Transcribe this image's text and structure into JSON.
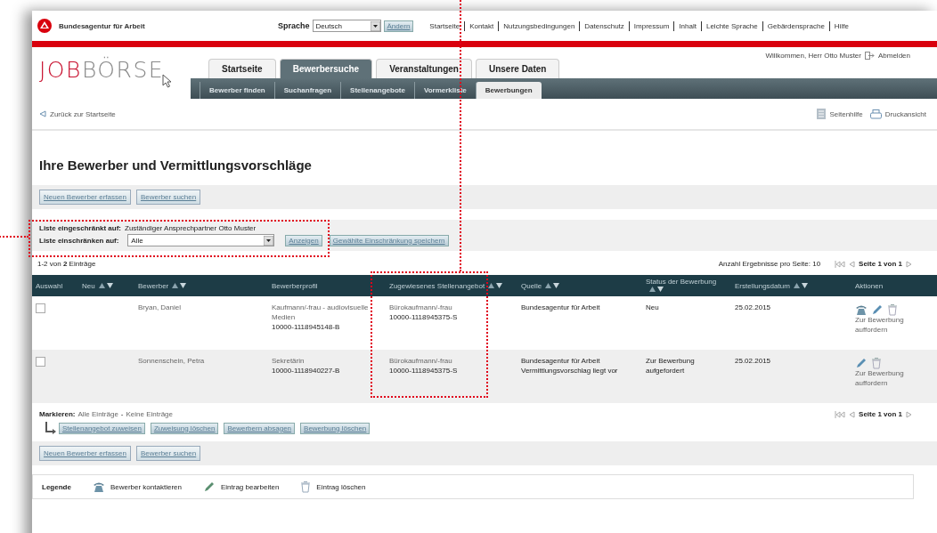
{
  "header": {
    "agency": "Bundesagentur für Arbeit",
    "language_label": "Sprache",
    "language_value": "Deutsch",
    "language_button": "Ändern",
    "links": [
      "Startseite",
      "Kontakt",
      "Nutzungsbedingungen",
      "Datenschutz",
      "Impressum",
      "Inhalt",
      "Leichte Sprache",
      "Gebärdensprache",
      "Hilfe"
    ]
  },
  "logo": {
    "accent": "JOB",
    "rest": "BÖRSE"
  },
  "user": {
    "welcome": "Willkommen, Herr Otto Muster",
    "logout": "Abmelden"
  },
  "tabs": [
    {
      "label": "Startseite",
      "selected": false
    },
    {
      "label": "Bewerbersuche",
      "selected": true
    },
    {
      "label": "Veranstaltungen",
      "selected": false
    },
    {
      "label": "Unsere Daten",
      "selected": false
    }
  ],
  "subtabs": [
    {
      "label": "Bewerber finden",
      "selected": false
    },
    {
      "label": "Suchanfragen",
      "selected": false
    },
    {
      "label": "Stellenangebote",
      "selected": false
    },
    {
      "label": "Vormerkliste",
      "selected": false
    },
    {
      "label": "Bewerbungen",
      "selected": true
    }
  ],
  "toolbar": {
    "back": "Zurück zur Startseite",
    "help": "Seitenhilfe",
    "print": "Druckansicht"
  },
  "title": "Ihre Bewerber und Vermittlungsvorschläge",
  "top_buttons": [
    "Neuen Bewerber erfassen",
    "Bewerber suchen"
  ],
  "filter": {
    "restricted_label": "Liste eingeschränkt auf:",
    "restricted_value": "Zuständiger Ansprechpartner Otto Muster",
    "restrict_label": "Liste einschränken auf:",
    "select_value": "Alle",
    "buttons": [
      "Anzeigen",
      "Gewählte Einschränkung speichern"
    ]
  },
  "count": "1-2 von **2** Einträge",
  "per_page": "Anzahl Ergebnisse pro Seite: 10",
  "pager": "Seite 1 von 1",
  "table": {
    "columns": [
      {
        "label": "Auswahl",
        "sortable": false
      },
      {
        "label": "Neu",
        "sortable": true
      },
      {
        "label": "Bewerber",
        "sortable": true
      },
      {
        "label": "Bewerberprofil",
        "sortable": false
      },
      {
        "label": "Zugewiesenes Stellenangebot",
        "sortable": true
      },
      {
        "label": "Quelle",
        "sortable": true
      },
      {
        "label": "Status der Bewerbung",
        "sortable": true
      },
      {
        "label": "Erstellungsdatum",
        "sortable": true
      },
      {
        "label": "Aktionen",
        "sortable": false
      }
    ],
    "rows": [
      {
        "checked": false,
        "applicant": "Bryan, Daniel",
        "profile": "Kaufmann/-frau - audiovisuelle Medien",
        "profile_ref": "10000-1118945148-B",
        "offer": "Bürokaufmann/-frau",
        "offer_ref": "10000-1118945375-S",
        "source": "Bundesagentur für Arbeit",
        "status": "Neu",
        "date": "25.02.2015",
        "actions": [
          {
            "kind": "contact"
          },
          {
            "kind": "edit"
          },
          {
            "kind": "delete"
          }
        ],
        "action_link": "Zur Bewerbung auffordern"
      },
      {
        "checked": false,
        "applicant": "Sonnenschein, Petra",
        "profile": "Sekretärin",
        "profile_ref": "10000-1118940227-B",
        "offer": "Bürokaufmann/-frau",
        "offer_ref": "10000-1118945375-S",
        "source": "Bundesagentur für Arbeit Vermittlungsvorschlag liegt vor",
        "status": "Zur Bewerbung aufgefordert",
        "date": "25.02.2015",
        "actions": [
          {
            "kind": "edit"
          },
          {
            "kind": "delete"
          }
        ],
        "action_link": "Zur Bewerbung auffordern"
      }
    ]
  },
  "mark": {
    "label": "Markieren:",
    "all": "Alle Einträge",
    "separator": "-",
    "none": "Keine Einträge"
  },
  "bulk_buttons": [
    "Stellenangebot zuweisen",
    "Zuweisung löschen",
    "Bewerbern absagen",
    "Bewerbung löschen"
  ],
  "bottom_buttons": [
    "Neuen Bewerber erfassen",
    "Bewerber suchen"
  ],
  "pager_bottom": "Seite 1 von 1",
  "legend": {
    "label": "Legende",
    "items": [
      {
        "kind": "contact",
        "label": "Bewerber kontaktieren"
      },
      {
        "kind": "edit",
        "label": "Eintrag bearbeiten"
      },
      {
        "kind": "delete",
        "label": "Eintrag löschen"
      }
    ]
  }
}
